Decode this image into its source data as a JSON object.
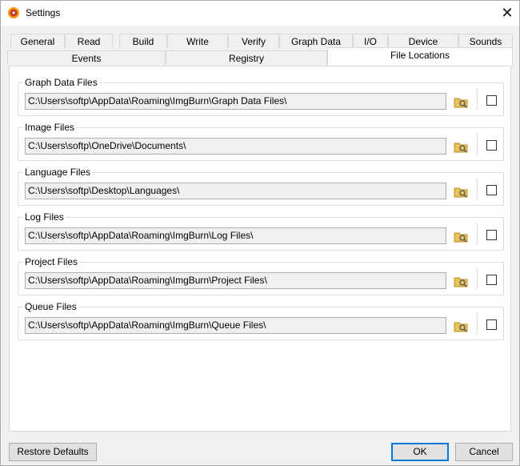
{
  "window": {
    "title": "Settings",
    "close_glyph": "✕"
  },
  "tabs_row1": [
    "General",
    "Read",
    "Build",
    "Write",
    "Verify",
    "Graph Data",
    "I/O",
    "Device",
    "Sounds"
  ],
  "tabs_row2": [
    "Events",
    "Registry",
    "File Locations"
  ],
  "active_tab": "File Locations",
  "groups": [
    {
      "label": "Graph Data Files",
      "path": "C:\\Users\\softp\\AppData\\Roaming\\ImgBurn\\Graph Data Files\\",
      "checked": false
    },
    {
      "label": "Image Files",
      "path": "C:\\Users\\softp\\OneDrive\\Documents\\",
      "checked": false
    },
    {
      "label": "Language Files",
      "path": "C:\\Users\\softp\\Desktop\\Languages\\",
      "checked": false
    },
    {
      "label": "Log Files",
      "path": "C:\\Users\\softp\\AppData\\Roaming\\ImgBurn\\Log Files\\",
      "checked": false
    },
    {
      "label": "Project Files",
      "path": "C:\\Users\\softp\\AppData\\Roaming\\ImgBurn\\Project Files\\",
      "checked": false
    },
    {
      "label": "Queue Files",
      "path": "C:\\Users\\softp\\AppData\\Roaming\\ImgBurn\\Queue Files\\",
      "checked": false
    }
  ],
  "buttons": {
    "restore": "Restore Defaults",
    "ok": "OK",
    "cancel": "Cancel"
  },
  "icons": {
    "app": "imgburn-app-icon",
    "browse": "folder-browse-icon",
    "close": "close-icon"
  },
  "colors": {
    "accent": "#0078d7",
    "folder": "#e8c25a"
  }
}
